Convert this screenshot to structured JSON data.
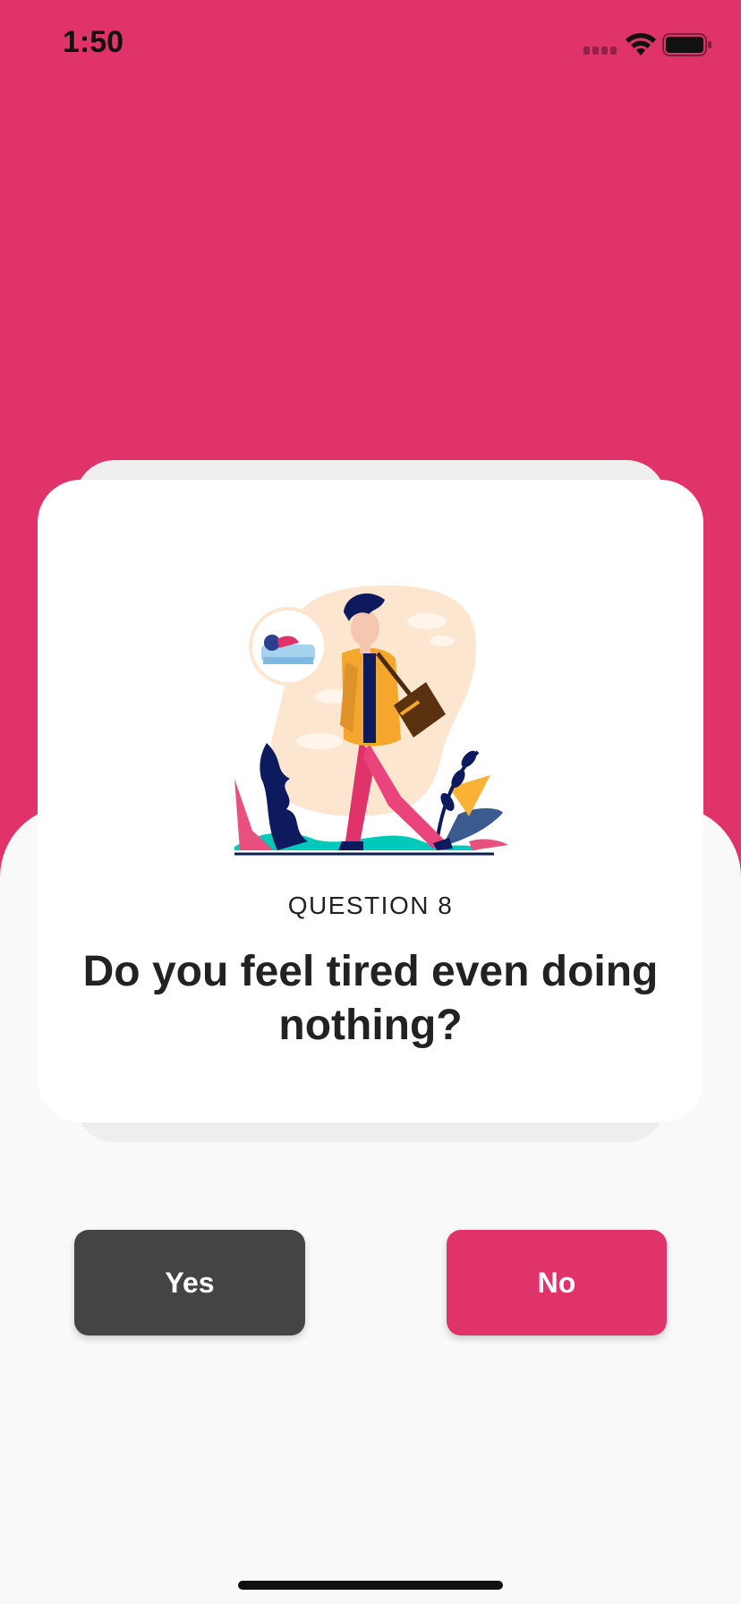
{
  "status_bar": {
    "time": "1:50",
    "icons": [
      "signal-icon",
      "wifi-icon",
      "battery-icon"
    ]
  },
  "colors": {
    "accent": "#e0336a",
    "yes_button": "#444444",
    "no_button": "#e0336a",
    "background": "#f9f9f9",
    "card": "#ffffff"
  },
  "question": {
    "number_label": "QUESTION 8",
    "text": "Do you feel tired even doing nothing?",
    "illustration": "tired-person-illustration"
  },
  "answers": {
    "yes_label": "Yes",
    "no_label": "No"
  }
}
